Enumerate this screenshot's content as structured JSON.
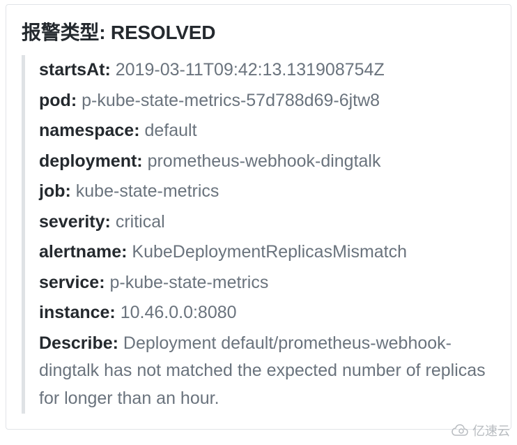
{
  "card": {
    "titleLabel": "报警类型:",
    "titleValue": "RESOLVED",
    "fields": [
      {
        "label": "startsAt:",
        "value": "2019-03-11T09:42:13.131908754Z"
      },
      {
        "label": "pod:",
        "value": "p-kube-state-metrics-57d788d69-6jtw8"
      },
      {
        "label": "namespace:",
        "value": "default"
      },
      {
        "label": "deployment:",
        "value": "prometheus-webhook-dingtalk"
      },
      {
        "label": "job:",
        "value": "kube-state-metrics"
      },
      {
        "label": "severity:",
        "value": "critical"
      },
      {
        "label": "alertname:",
        "value": "KubeDeploymentReplicasMismatch"
      },
      {
        "label": "service:",
        "value": "p-kube-state-metrics"
      },
      {
        "label": "instance:",
        "value": "10.46.0.0:8080"
      },
      {
        "label": "Describe:",
        "value": "Deployment default/prometheus-webhook-dingtalk has not matched the expected number of replicas for longer than an hour."
      }
    ]
  },
  "watermark": {
    "text": "亿速云"
  }
}
